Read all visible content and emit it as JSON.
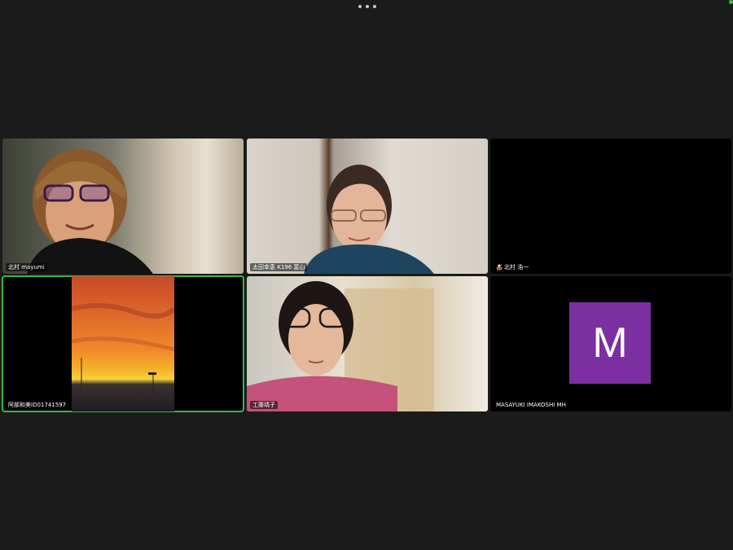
{
  "participants": [
    {
      "name": "北村 mayumi",
      "muted": false
    },
    {
      "name": "太田幸恵 K196 富山",
      "muted": false
    },
    {
      "name": "北村 浩一",
      "muted": true
    },
    {
      "name": "阿部和美ID01741597",
      "muted": false,
      "active_speaker": true
    },
    {
      "name": "工藤靖子",
      "muted": false
    },
    {
      "name": "MASAYUKI IMAKOSHI  MH",
      "muted": false,
      "avatar_letter": "M",
      "avatar_color": "#7b2fa0"
    }
  ],
  "colors": {
    "active_speaker_border": "#2fbb45",
    "background": "#1b1b1b"
  },
  "icons": {
    "more": "more-options-icon",
    "muted": "mic-muted-icon"
  }
}
